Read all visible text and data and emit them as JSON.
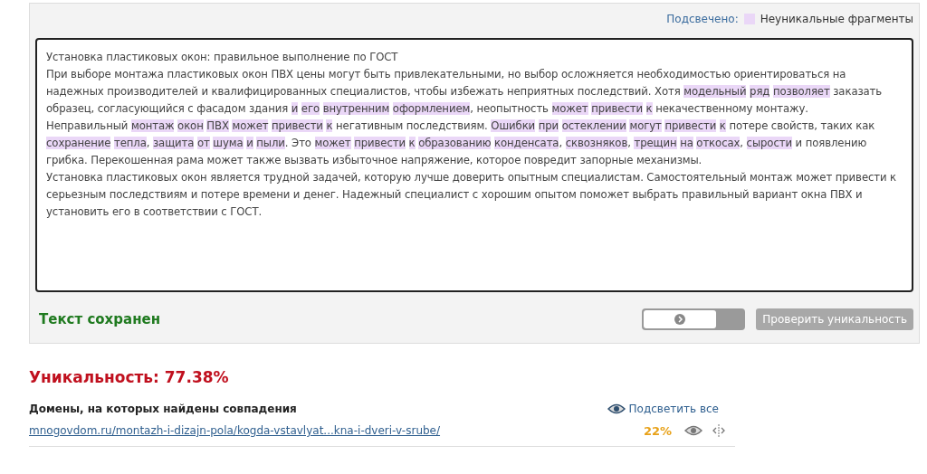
{
  "legend": {
    "label": "Подсвечено:",
    "text": "Неуникальные фрагменты"
  },
  "editor": {
    "paragraphs": [
      [
        {
          "text": "Установка пластиковых окон: правильное выполнение по ГОСТ",
          "highlighted": false
        }
      ],
      [
        {
          "text": "При выборе монтажа пластиковых окон ПВХ цены могут быть привлекательными, но выбор осложняется необходимостью ориентироваться на надежных производителей и квалифицированных специалистов, чтобы избежать неприятных последствий. Хотя ",
          "highlighted": false
        },
        {
          "text": "модельный ряд позволяет",
          "highlighted": true
        },
        {
          "text": " заказать образец, согласующийся с фасадом здания ",
          "highlighted": false
        },
        {
          "text": "и его внутренним оформлением",
          "highlighted": true
        },
        {
          "text": ", неопытность ",
          "highlighted": false
        },
        {
          "text": "может привести к",
          "highlighted": true
        },
        {
          "text": " некачественному монтажу.",
          "highlighted": false
        }
      ],
      [
        {
          "text": "Неправильный ",
          "highlighted": false
        },
        {
          "text": "монтаж окон ПВХ может привести к",
          "highlighted": true
        },
        {
          "text": " негативным последствиям. ",
          "highlighted": false
        },
        {
          "text": "Ошибки при остеклении могут привести к",
          "highlighted": true
        },
        {
          "text": " потере свойств, таких как ",
          "highlighted": false
        },
        {
          "text": "сохранение тепла",
          "highlighted": true
        },
        {
          "text": ", ",
          "highlighted": false
        },
        {
          "text": "защита от шума и пыли",
          "highlighted": true
        },
        {
          "text": ". Это ",
          "highlighted": false
        },
        {
          "text": "может привести к образованию конденсата",
          "highlighted": true
        },
        {
          "text": ", ",
          "highlighted": false
        },
        {
          "text": "сквозняков",
          "highlighted": true
        },
        {
          "text": ", ",
          "highlighted": false
        },
        {
          "text": "трещин на откосах",
          "highlighted": true
        },
        {
          "text": ", ",
          "highlighted": false
        },
        {
          "text": "сырости",
          "highlighted": true
        },
        {
          "text": " и появлению грибка. Перекошенная рама может также вызвать избыточное напряжение, которое повредит запорные механизмы.",
          "highlighted": false
        }
      ],
      [
        {
          "text": "Установка пластиковых окон является трудной задачей, которую лучше доверить опытным специалистам. Самостоятельный монтаж может привести к серьезным последствиям и потере времени и денег. Надежный специалист с хорошим опытом поможет выбрать правильный вариант окна ПВХ и установить его в соответствии с ГОСТ.",
          "highlighted": false
        }
      ]
    ]
  },
  "status": "Текст сохранен",
  "toggle": {
    "on": false
  },
  "check_button": "Проверить уникальность",
  "uniqueness": "Уникальность: 77.38%",
  "domains": {
    "title": "Домены, на которых найдены совпадения",
    "highlight_all": "Подсветить все",
    "rows": [
      {
        "url": "mnogovdom.ru/montazh-i-dizajn-pola/kogda-vstavlyat...kna-i-dveri-v-srube/",
        "percent": "22%"
      }
    ]
  }
}
